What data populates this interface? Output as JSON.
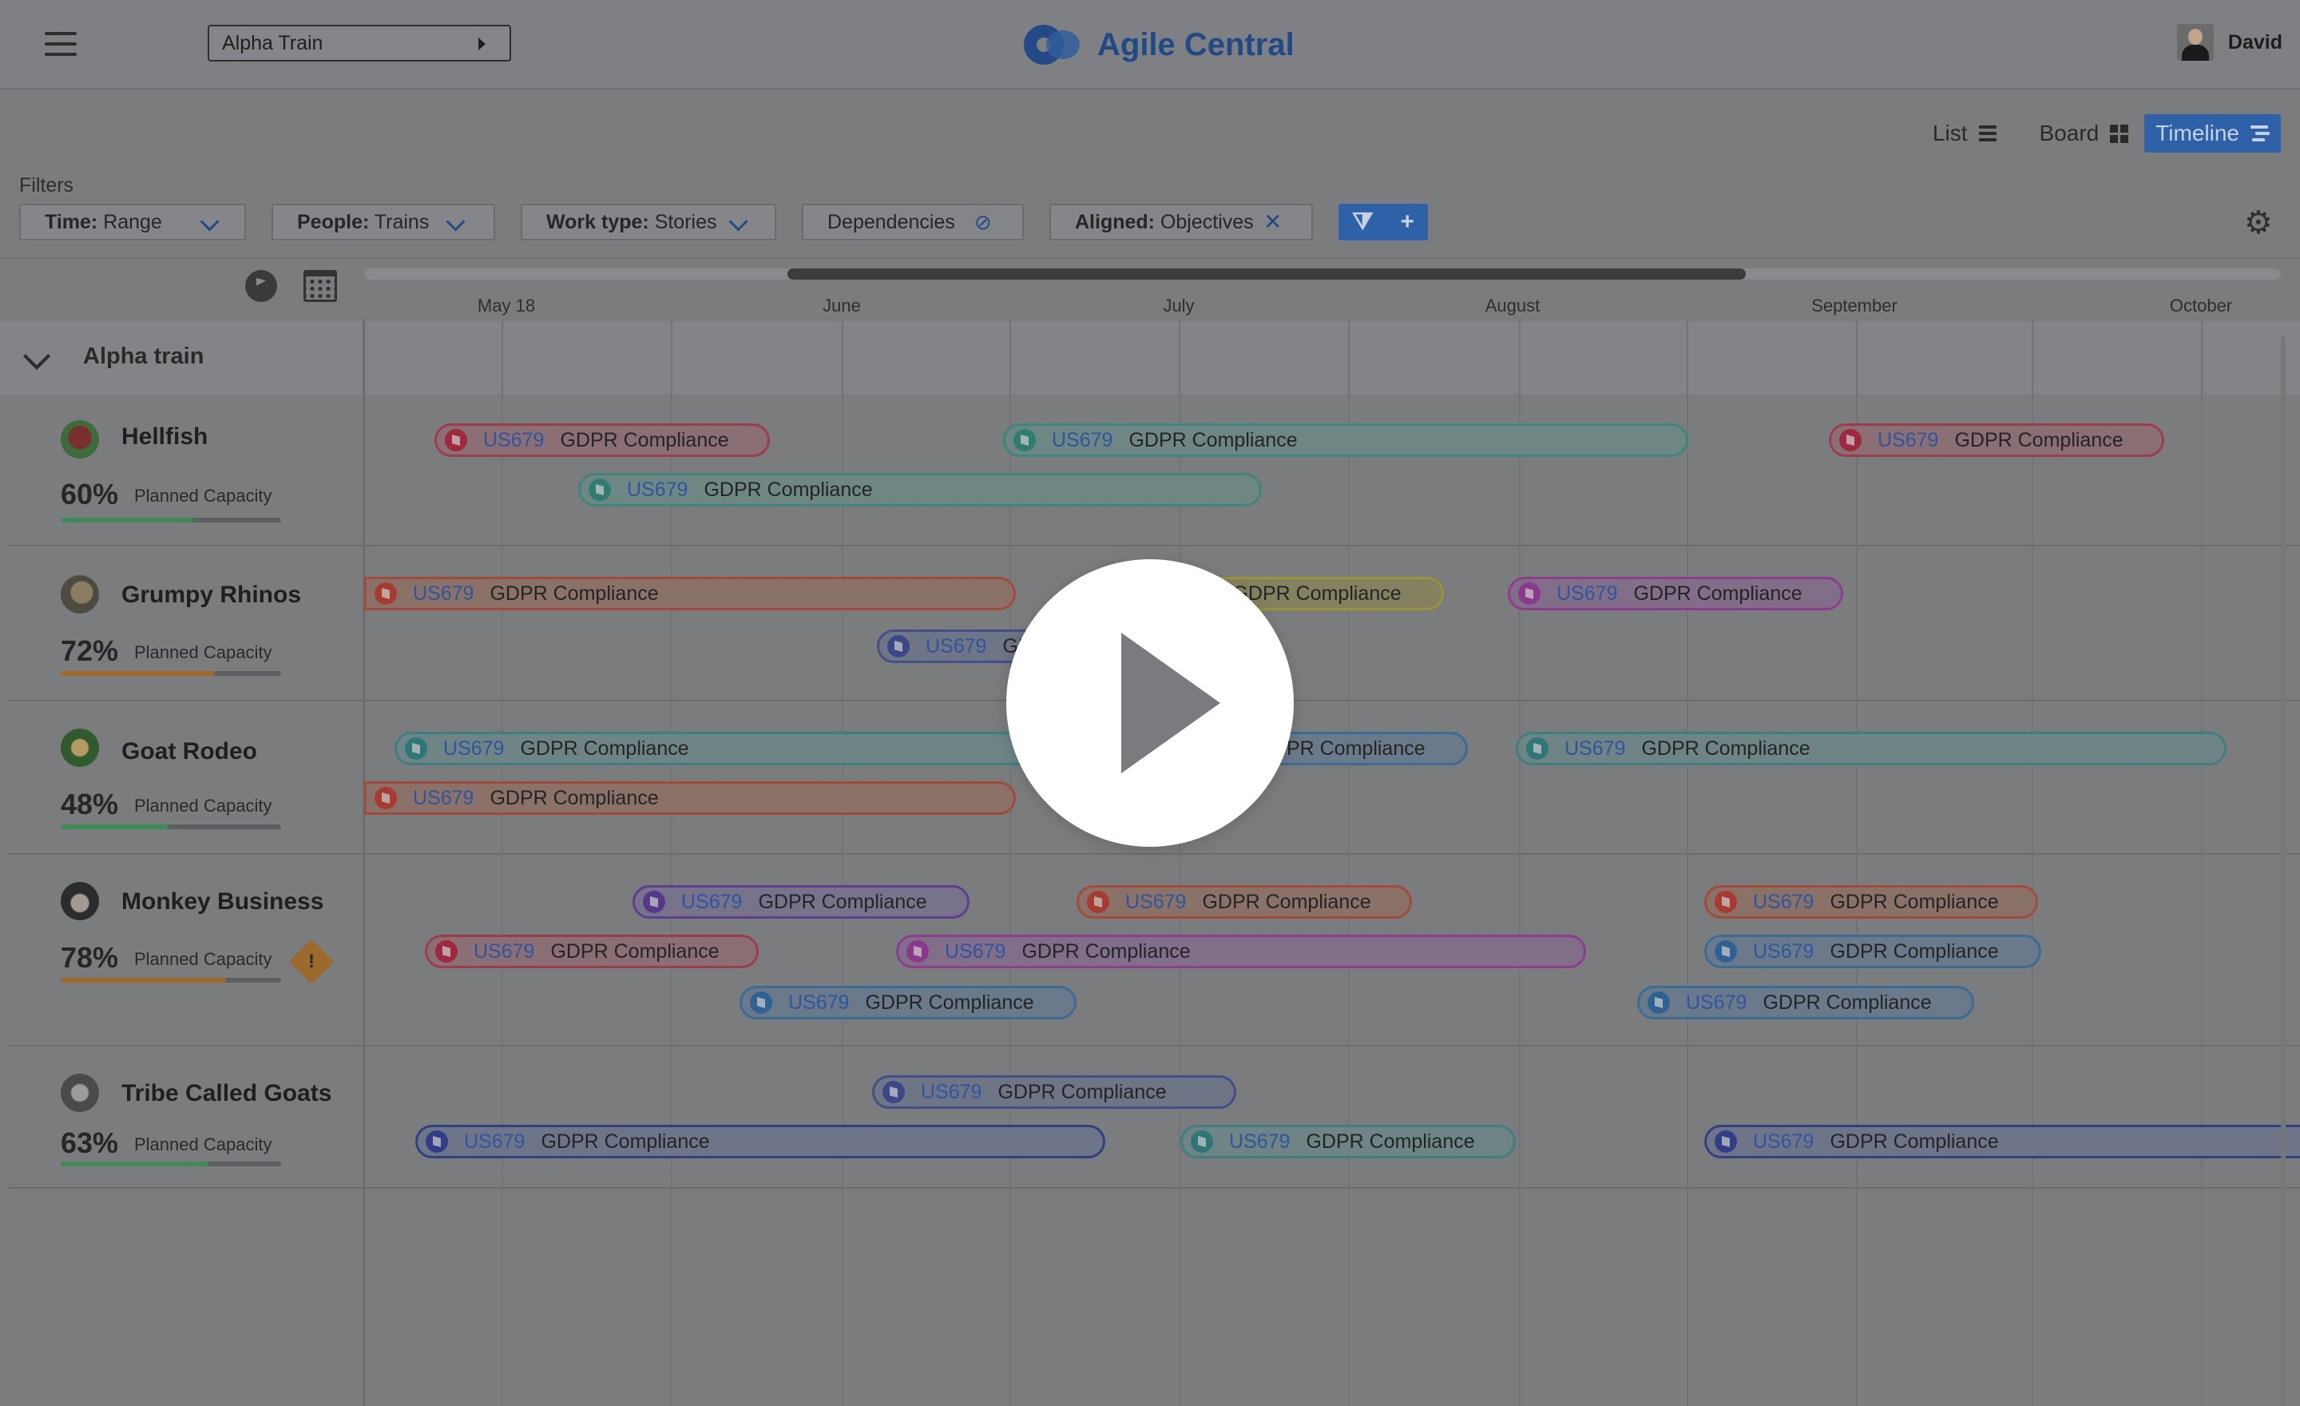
{
  "header": {
    "train_select": "Alpha Train",
    "brand": "Agile Central",
    "user_name": "David"
  },
  "views": {
    "list": "List",
    "board": "Board",
    "timeline": "Timeline",
    "active": "Timeline"
  },
  "filters": {
    "label": "Filters",
    "time_key": "Time:",
    "time_val": "Range",
    "people_key": "People:",
    "people_val": "Trains",
    "work_key": "Work type:",
    "work_val": "Stories",
    "dependencies": "Dependencies",
    "aligned_key": "Aligned:",
    "aligned_val": "Objectives"
  },
  "months": [
    "May 18",
    "June",
    "July",
    "August",
    "September",
    "October"
  ],
  "group": {
    "title": "Alpha train"
  },
  "capacity_label": "Planned Capacity",
  "teams": [
    {
      "name": "Hellfish",
      "pct": "60%",
      "capacity": 0.6,
      "bar_color": "#3f8a55"
    },
    {
      "name": "Grumpy Rhinos",
      "pct": "72%",
      "capacity": 0.7,
      "bar_color": "#a06a2c"
    },
    {
      "name": "Goat Rodeo",
      "pct": "48%",
      "capacity": 0.49,
      "bar_color": "#3f8a55"
    },
    {
      "name": "Monkey Business",
      "pct": "78%",
      "capacity": 0.75,
      "bar_color": "#a06a2c"
    },
    {
      "name": "Tribe Called Goats",
      "pct": "63%",
      "capacity": 0.67,
      "bar_color": "#3f8a55"
    }
  ],
  "story": {
    "id": "US679",
    "name": "GDPR Compliance"
  },
  "colors": {
    "brand_blue": "#1f4a86",
    "active_view": "#2f61a8",
    "story_id": "#2d55a0"
  }
}
